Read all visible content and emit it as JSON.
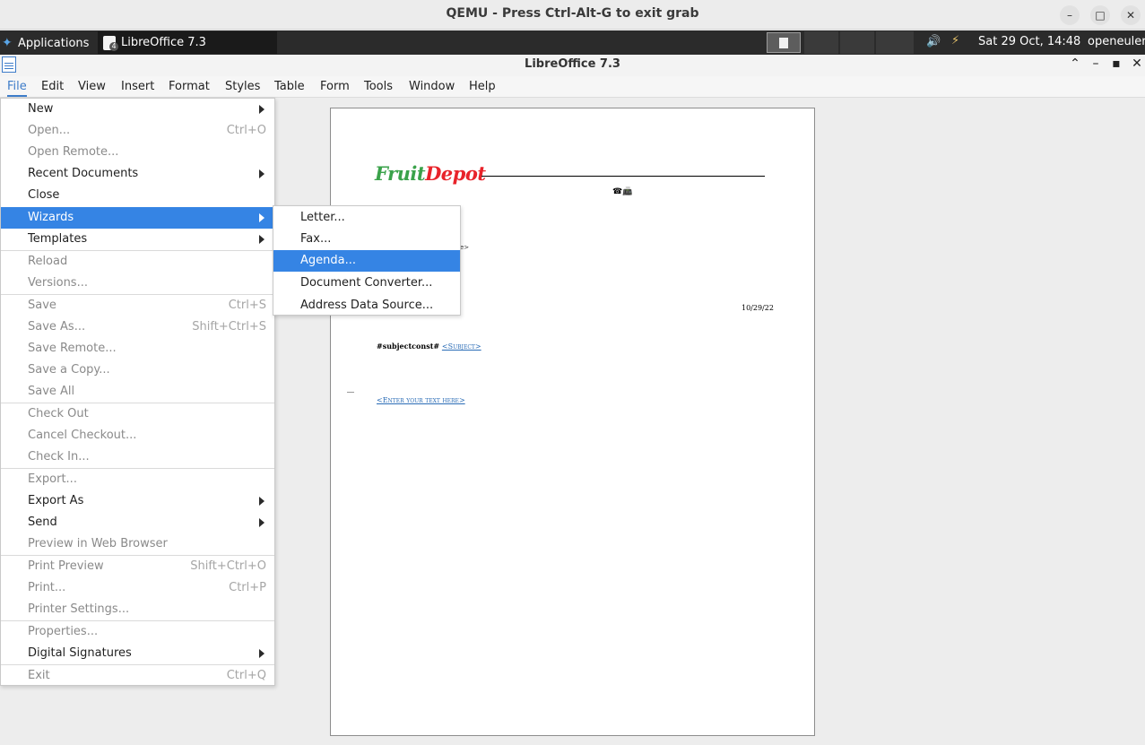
{
  "qemu": {
    "title": "QEMU - Press Ctrl-Alt-G to exit grab",
    "minimize": "–",
    "maximize": "□",
    "close": "✕"
  },
  "panel": {
    "applications": "Applications",
    "task_label": "LibreOffice 7.3",
    "clock": "Sat 29 Oct, 14:48",
    "user": "openeuler",
    "volume_icon": "🔊",
    "network_icon": "⚡"
  },
  "window": {
    "title": "LibreOffice 7.3",
    "restore": "⌃",
    "minimize": "–",
    "maximize": "▪",
    "close": "✕"
  },
  "menubar": [
    "File",
    "Edit",
    "View",
    "Insert",
    "Format",
    "Styles",
    "Table",
    "Form",
    "Tools",
    "Window",
    "Help"
  ],
  "file_menu": [
    {
      "label": "New",
      "submenu": true
    },
    {
      "label": "Open...",
      "shortcut": "Ctrl+O",
      "disabled": true
    },
    {
      "label": "Open Remote...",
      "disabled": true
    },
    {
      "label": "Recent Documents",
      "submenu": true
    },
    {
      "label": "Close"
    },
    {
      "label": "Wizards",
      "submenu": true,
      "active": true
    },
    {
      "label": "Templates",
      "submenu": true
    },
    {
      "label": "Reload",
      "disabled": true
    },
    {
      "label": "Versions...",
      "disabled": true
    },
    {
      "label": "Save",
      "shortcut": "Ctrl+S",
      "disabled": true
    },
    {
      "label": "Save As...",
      "shortcut": "Shift+Ctrl+S",
      "disabled": true
    },
    {
      "label": "Save Remote...",
      "disabled": true
    },
    {
      "label": "Save a Copy...",
      "disabled": true
    },
    {
      "label": "Save All",
      "disabled": true
    },
    {
      "label": "Check Out",
      "disabled": true
    },
    {
      "label": "Cancel Checkout...",
      "disabled": true
    },
    {
      "label": "Check In...",
      "disabled": true
    },
    {
      "label": "Export...",
      "disabled": true
    },
    {
      "label": "Export As",
      "submenu": true
    },
    {
      "label": "Send",
      "submenu": true
    },
    {
      "label": "Preview in Web Browser",
      "disabled": true
    },
    {
      "label": "Print Preview",
      "shortcut": "Shift+Ctrl+O",
      "disabled": true
    },
    {
      "label": "Print...",
      "shortcut": "Ctrl+P",
      "disabled": true
    },
    {
      "label": "Printer Settings...",
      "disabled": true
    },
    {
      "label": "Properties...",
      "disabled": true
    },
    {
      "label": "Digital Signatures",
      "submenu": true
    },
    {
      "label": "Exit",
      "shortcut": "Ctrl+Q",
      "disabled": true
    }
  ],
  "wizards_submenu": [
    {
      "label": "Letter..."
    },
    {
      "label": "Fax..."
    },
    {
      "label": "Agenda...",
      "active": true
    },
    {
      "label": "Document Converter..."
    },
    {
      "label": "Address Data Source..."
    }
  ],
  "document": {
    "logo_part1": "Fruit",
    "logo_part2": "Depot",
    "contact_icons": "☎📠",
    "mark": "e>",
    "date": "10/29/22",
    "subject_const": "#subjectconst#",
    "subject_field": "<Subject>",
    "body_placeholder": "<Enter your text here>"
  },
  "colors": {
    "accent": "#3584e4",
    "panel": "#2b2b2b",
    "link": "#2a6cb6"
  }
}
